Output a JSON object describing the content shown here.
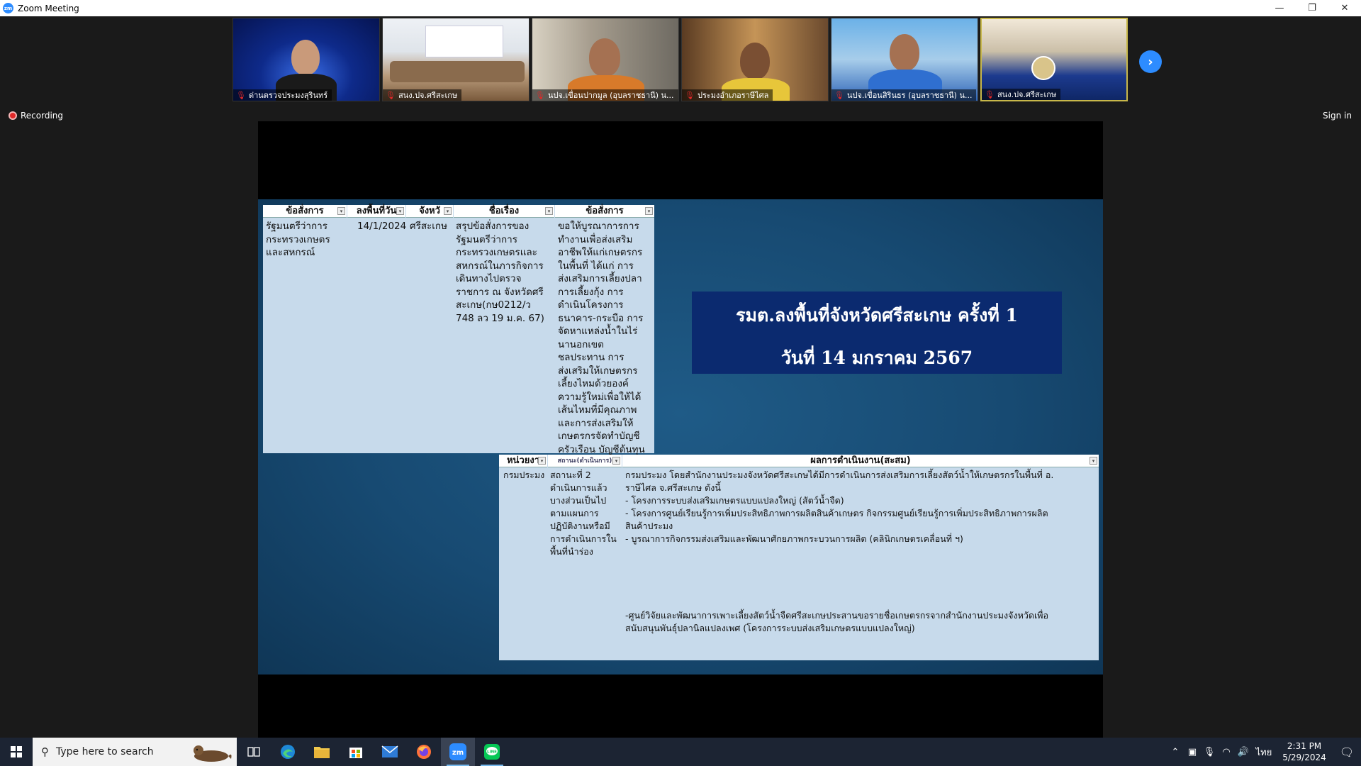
{
  "window": {
    "title": "Zoom Meeting",
    "app_icon": "zm",
    "minimize": "—",
    "restore": "❐",
    "close": "✕"
  },
  "participants": [
    {
      "name": "ด่านตรวจประมงสุรินทร์",
      "muted": true
    },
    {
      "name": "สนง.ปจ.ศรีสะเกษ",
      "muted": true
    },
    {
      "name": "นปจ.เขื่อนปากมูล (อุบลราชธานี) น...",
      "muted": true
    },
    {
      "name": "ประมงอำเภอราษีไศล",
      "muted": true
    },
    {
      "name": "นปจ.เขื่อนสิรินธร (อุบลราชธานี) น...",
      "muted": true
    },
    {
      "name": "สนง.ปจ.ศรีสะเกษ",
      "muted": true,
      "active": true
    }
  ],
  "status": {
    "recording": "Recording",
    "signin": "Sign in"
  },
  "sheet1": {
    "headers": [
      "ข้อสั่งการ",
      "ลงพื้นที่วัน",
      "จังหวั",
      "ชื่อเรื่อง",
      "ข้อสั่งการ"
    ],
    "row": {
      "col1": "รัฐมนตรีว่าการ\nกระทรวงเกษตร\nและสหกรณ์",
      "col2": "14/1/2024",
      "col3": "ศรีสะเกษ",
      "col4": "สรุปข้อสั่งการของ\nรัฐมนตรีว่าการ\nกระทรวงเกษตรและ\nสหกรณ์ในภารกิจการ\nเดินทางไปตรวจ\nราชการ ณ จังหวัดศรี\nสะเกษ(กษ0212/ว\n748 ลว 19 ม.ค. 67)",
      "col5": "ขอให้บูรณาการการ\nทำงานเพื่อส่งเสริม\nอาชีพให้แก่เกษตรกร\nในพื้นที่ ได้แก่ การ\nส่งเสริมการเลี้ยงปลา\nการเลี้ยงกุ้ง การ\nดำเนินโครงการ\nธนาคาร-กระบือ การ\nจัดหาแหล่งน้ำในไร่\nนานอกเขต\nชลประทาน การ\nส่งเสริมให้เกษตรกร\nเลี้ยงไหมด้วยองค์\nความรู้ใหม่เพื่อให้ได้\nเส้นไหมที่มีคุณภาพ\nและการส่งเสริมให้\nเกษตรกรจัดทำบัญชี\nครัวเรือน บัญชีต้นทุน"
    }
  },
  "banner": {
    "line1": "รมต.ลงพื้นที่จังหวัดศรีสะเกษ ครั้งที่ 1",
    "line2": "วันที่ 14 มกราคม 2567"
  },
  "sheet2": {
    "headers": [
      "หน่วยงา",
      "สถานะ(ดำเนินการ)",
      "ผลการดำเนินงาน(สะสม)"
    ],
    "row": {
      "col1": "กรมประมง",
      "col2": "สถานะที่ 2\nดำเนินการแล้ว\nบางส่วนเป็นไป\nตามแผนการ\nปฏิบัติงานหรือมี\nการดำเนินการใน\nพื้นที่นำร่อง",
      "col3a": "กรมประมง โดยสำนักงานประมงจังหวัดศรีสะเกษได้มีการดำเนินการส่งเสริมการเลี้ยงสัตว์น้ำให้เกษตรกรในพื้นที่ อ.\nราษีไศล จ.ศรีสะเกษ  ดังนี้\n- โครงการระบบส่งเสริมเกษตรแบบแปลงใหญ่ (สัตว์น้ำจืด)\n- โครงการศูนย์เรียนรู้การเพิ่มประสิทธิภาพการผลิตสินค้าเกษตร กิจกรรมศูนย์เรียนรู้การเพิ่มประสิทธิภาพการผลิต\nสินค้าประมง\n- บูรณาการกิจกรรมส่งเสริมและพัฒนาศักยภาพกระบวนการผลิต (คลินิกเกษตรเคลื่อนที่ ฯ)",
      "col3b": "-ศูนย์วิจัยและพัฒนาการเพาะเลี้ยงสัตว์น้ำจืดศรีสะเกษประสานขอรายชื่อเกษตรกรจากสำนักงานประมงจังหวัดเพื่อ\nสนับสนุนพันธุ์ปลานิลแปลงเพศ  (โครงการระบบส่งเสริมเกษตรแบบแปลงใหญ่)"
    }
  },
  "taskbar": {
    "search_placeholder": "Type here to search",
    "apps": [
      "task-view-icon",
      "edge-icon",
      "file-explorer-icon",
      "store-icon",
      "mail-icon",
      "firefox-icon",
      "zoom-icon",
      "line-icon"
    ],
    "time": "2:31 PM",
    "date": "5/29/2024",
    "lang": "ไทย"
  },
  "colors": {
    "zoom_blue": "#2d8cff",
    "slide_bg": "#174a72",
    "banner_bg": "#0b2a6f",
    "sheet_bg": "#c7daeb",
    "taskbar_bg": "#1c2433"
  }
}
